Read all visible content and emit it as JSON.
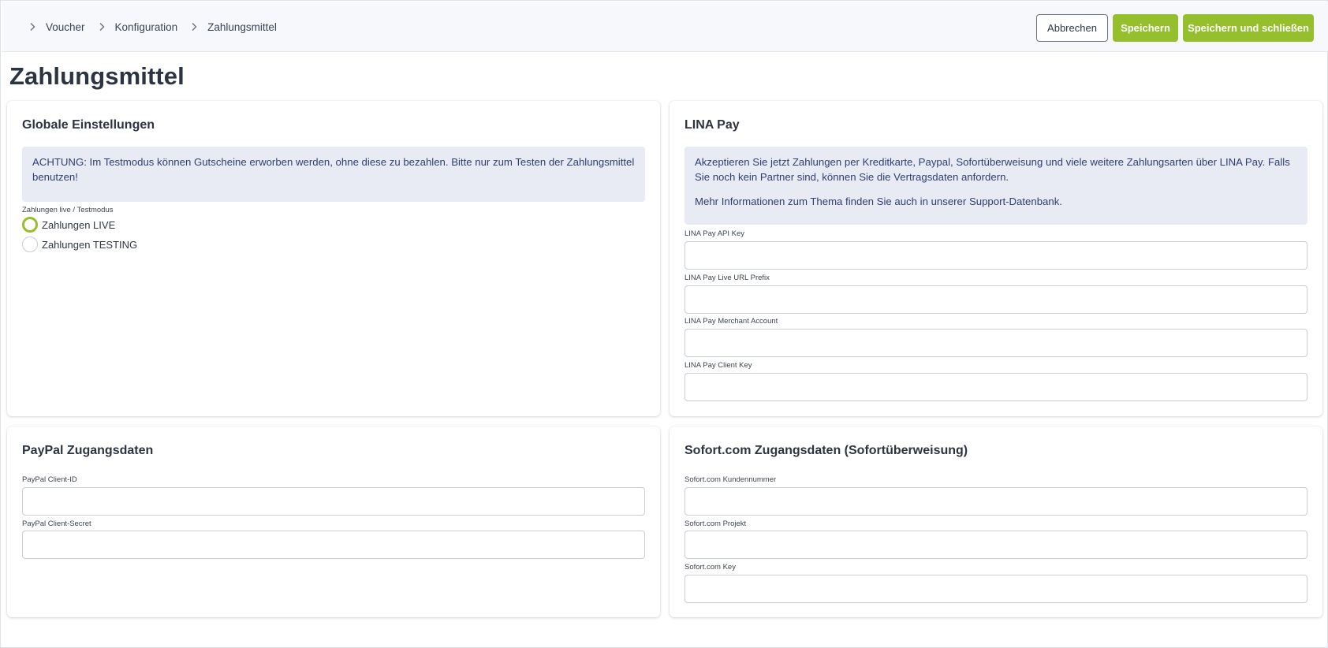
{
  "breadcrumb": {
    "items": [
      {
        "label": "Voucher"
      },
      {
        "label": "Konfiguration"
      },
      {
        "label": "Zahlungsmittel"
      }
    ]
  },
  "toolbar": {
    "cancel_label": "Abbrechen",
    "save_label": "Speichern",
    "save_close_label": "Speichern und schließen"
  },
  "page": {
    "title": "Zahlungsmittel"
  },
  "global": {
    "title": "Globale Einstellungen",
    "alert": "ACHTUNG: Im Testmodus können Gutscheine erworben werden, ohne diese zu bezahlen. Bitte nur zum Testen der Zahlungsmittel benutzen!",
    "mode_label": "Zahlungen live / Testmodus",
    "options": [
      {
        "label": "Zahlungen LIVE",
        "checked": true
      },
      {
        "label": "Zahlungen TESTING",
        "checked": false
      }
    ]
  },
  "linapay": {
    "title": "LINA Pay",
    "alert_p1": "Akzeptieren Sie jetzt Zahlungen per Kreditkarte, Paypal, Sofortüberweisung und viele weitere Zahlungsarten über LINA Pay. Falls Sie noch kein Partner sind, können Sie die Vertragsdaten anfordern.",
    "alert_p2": "Mehr Informationen zum Thema finden Sie auch in unserer Support-Datenbank.",
    "fields": [
      {
        "label": "LINA Pay API Key",
        "value": ""
      },
      {
        "label": "LINA Pay Live URL Prefix",
        "value": ""
      },
      {
        "label": "LINA Pay Merchant Account",
        "value": ""
      },
      {
        "label": "LINA Pay Client Key",
        "value": ""
      }
    ]
  },
  "paypal": {
    "title": "PayPal Zugangsdaten",
    "fields": [
      {
        "label": "PayPal Client-ID",
        "value": ""
      },
      {
        "label": "PayPal Client-Secret",
        "value": ""
      }
    ]
  },
  "sofort": {
    "title": "Sofort.com Zugangsdaten (Sofortüberweisung)",
    "fields": [
      {
        "label": "Sofort.com Kundennummer",
        "value": ""
      },
      {
        "label": "Sofort.com Projekt",
        "value": ""
      },
      {
        "label": "Sofort.com Key",
        "value": ""
      }
    ]
  },
  "colors": {
    "accent": "#95bf2d",
    "alert_bg": "#e8ebf3",
    "alert_text": "#2d3f73",
    "topbar_bg": "#f6f8fb"
  }
}
